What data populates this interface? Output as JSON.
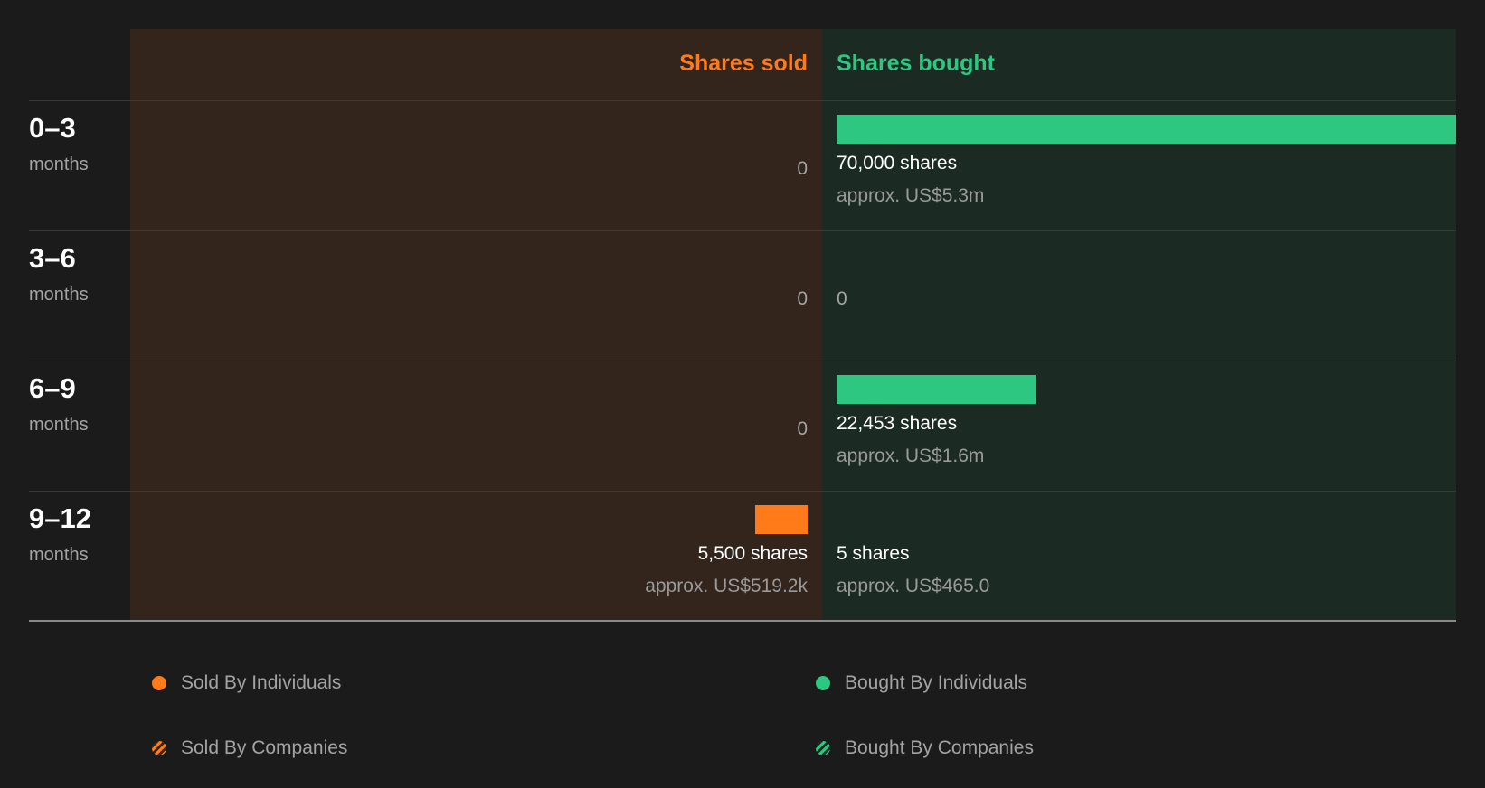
{
  "chart_data": {
    "type": "bar",
    "headers": {
      "sold": "Shares sold",
      "bought": "Shares bought"
    },
    "colors": {
      "sold": "#ff7b1a",
      "bought": "#2ec781",
      "sold_bg": "#33241c",
      "bought_bg": "#1c2a24"
    },
    "categories": [
      "0–3",
      "3–6",
      "6–9",
      "9–12"
    ],
    "category_unit": "months",
    "series": [
      {
        "name": "Shares sold",
        "values": [
          0,
          0,
          0,
          5500
        ]
      },
      {
        "name": "Shares bought",
        "values": [
          70000,
          0,
          22453,
          5
        ]
      }
    ],
    "rows": [
      {
        "range": "0–3",
        "unit": "months",
        "sold": {
          "value": 0,
          "label": "0",
          "shares": "",
          "approx": ""
        },
        "bought": {
          "value": 70000,
          "label": "",
          "shares": "70,000 shares",
          "approx": "approx. US$5.3m"
        }
      },
      {
        "range": "3–6",
        "unit": "months",
        "sold": {
          "value": 0,
          "label": "0",
          "shares": "",
          "approx": ""
        },
        "bought": {
          "value": 0,
          "label": "0",
          "shares": "",
          "approx": ""
        }
      },
      {
        "range": "6–9",
        "unit": "months",
        "sold": {
          "value": 0,
          "label": "0",
          "shares": "",
          "approx": ""
        },
        "bought": {
          "value": 22453,
          "label": "",
          "shares": "22,453 shares",
          "approx": "approx. US$1.6m"
        }
      },
      {
        "range": "9–12",
        "unit": "months",
        "sold": {
          "value": 5500,
          "label": "",
          "shares": "5,500 shares",
          "approx": "approx. US$519.2k"
        },
        "bought": {
          "value": 5,
          "label": "",
          "shares": "5 shares",
          "approx": "approx. US$465.0"
        }
      }
    ],
    "legend": [
      {
        "label": "Sold By Individuals",
        "marker": "solid",
        "color": "#ff7b1a"
      },
      {
        "label": "Bought By Individuals",
        "marker": "solid",
        "color": "#2ec781"
      },
      {
        "label": "Sold By Companies",
        "marker": "striped",
        "color": "#ff7b1a"
      },
      {
        "label": "Bought By Companies",
        "marker": "striped",
        "color": "#2ec781"
      }
    ]
  }
}
